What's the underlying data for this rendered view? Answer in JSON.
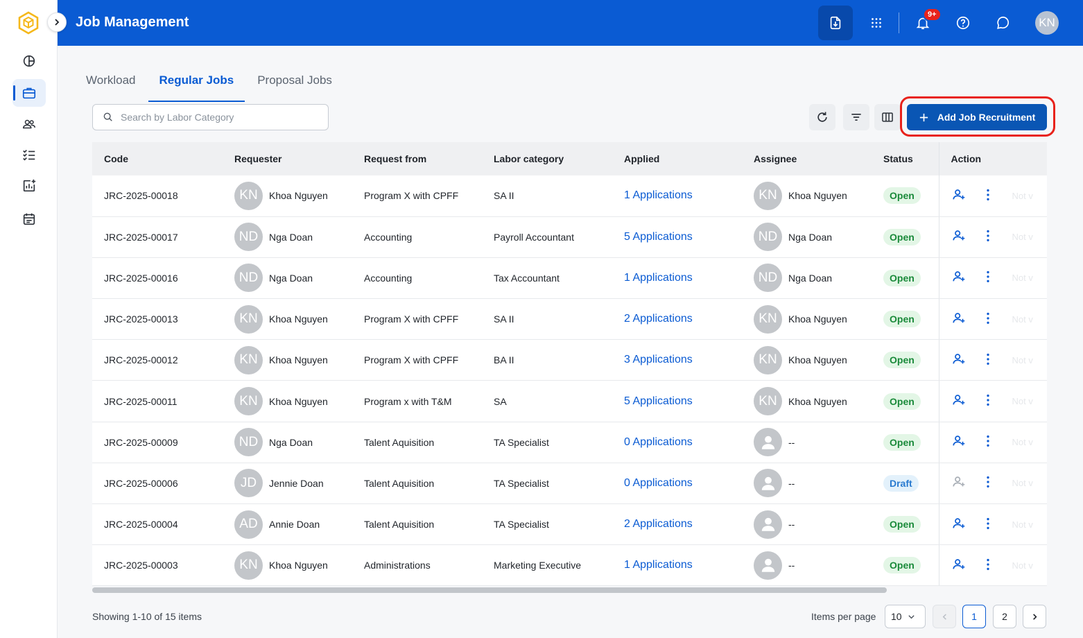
{
  "app": {
    "title": "Job Management",
    "logo_icon": "hexagon-cube-logo",
    "accent_color": "#0a5bd3",
    "header_color": "#0a5bd3"
  },
  "header": {
    "notification_badge": "9+",
    "avatar_initials": "KN",
    "icons": [
      "download-document-icon",
      "apps-grid-icon",
      "bell-icon",
      "help-icon",
      "chat-icon"
    ]
  },
  "sidebar": {
    "items": [
      {
        "name": "dashboard",
        "icon": "pie-chart-icon"
      },
      {
        "name": "jobs",
        "icon": "briefcase-icon",
        "active": true
      },
      {
        "name": "people",
        "icon": "users-icon"
      },
      {
        "name": "tasks",
        "icon": "checklist-icon"
      },
      {
        "name": "reports",
        "icon": "chart-add-icon"
      },
      {
        "name": "calendar",
        "icon": "calendar-icon"
      }
    ]
  },
  "tabs": [
    {
      "label": "Workload",
      "active": false
    },
    {
      "label": "Regular Jobs",
      "active": true
    },
    {
      "label": "Proposal Jobs",
      "active": false
    }
  ],
  "toolbar": {
    "search_placeholder": "Search by Labor Category",
    "add_button_label": "Add Job Recruitment"
  },
  "table": {
    "columns": [
      "Code",
      "Requester",
      "Request from",
      "Labor category",
      "Applied",
      "Assignee",
      "Status",
      "Action"
    ],
    "rows": [
      {
        "code": "JRC-2025-00018",
        "req_initials": "KN",
        "requester": "Khoa Nguyen",
        "from": "Program X with CPFF",
        "labor": "SA II",
        "applied": "1 Applications",
        "asg_initials": "KN",
        "assignee": "Khoa Nguyen",
        "status": "Open"
      },
      {
        "code": "JRC-2025-00017",
        "req_initials": "ND",
        "requester": "Nga Doan",
        "from": "Accounting",
        "labor": "Payroll Accountant",
        "applied": "5 Applications",
        "asg_initials": "ND",
        "assignee": "Nga Doan",
        "status": "Open"
      },
      {
        "code": "JRC-2025-00016",
        "req_initials": "ND",
        "requester": "Nga Doan",
        "from": "Accounting",
        "labor": "Tax Accountant",
        "applied": "1 Applications",
        "asg_initials": "ND",
        "assignee": "Nga Doan",
        "status": "Open"
      },
      {
        "code": "JRC-2025-00013",
        "req_initials": "KN",
        "requester": "Khoa Nguyen",
        "from": "Program X with CPFF",
        "labor": "SA II",
        "applied": "2 Applications",
        "asg_initials": "KN",
        "assignee": "Khoa Nguyen",
        "status": "Open"
      },
      {
        "code": "JRC-2025-00012",
        "req_initials": "KN",
        "requester": "Khoa Nguyen",
        "from": "Program X with CPFF",
        "labor": "BA II",
        "applied": "3 Applications",
        "asg_initials": "KN",
        "assignee": "Khoa Nguyen",
        "status": "Open"
      },
      {
        "code": "JRC-2025-00011",
        "req_initials": "KN",
        "requester": "Khoa Nguyen",
        "from": "Program x with T&M",
        "labor": "SA",
        "applied": "5 Applications",
        "asg_initials": "KN",
        "assignee": "Khoa Nguyen",
        "status": "Open"
      },
      {
        "code": "JRC-2025-00009",
        "req_initials": "ND",
        "requester": "Nga Doan",
        "from": "Talent Aquisition",
        "labor": "TA Specialist",
        "applied": "0 Applications",
        "asg_initials": "",
        "assignee": "--",
        "status": "Open"
      },
      {
        "code": "JRC-2025-00006",
        "req_initials": "JD",
        "requester": "Jennie Doan",
        "from": "Talent Aquisition",
        "labor": "TA Specialist",
        "applied": "0 Applications",
        "asg_initials": "",
        "assignee": "--",
        "status": "Draft"
      },
      {
        "code": "JRC-2025-00004",
        "req_initials": "AD",
        "requester": "Annie Doan",
        "from": "Talent Aquisition",
        "labor": "TA Specialist",
        "applied": "2 Applications",
        "asg_initials": "",
        "assignee": "--",
        "status": "Open"
      },
      {
        "code": "JRC-2025-00003",
        "req_initials": "KN",
        "requester": "Khoa Nguyen",
        "from": "Administrations",
        "labor": "Marketing Executive",
        "applied": "1 Applications",
        "asg_initials": "",
        "assignee": "--",
        "status": "Open"
      }
    ],
    "action_ghost_text": "Not v"
  },
  "footer": {
    "showing": "Showing 1-10 of 15 items",
    "items_per_page_label": "Items per page",
    "items_per_page_value": "10",
    "pages": [
      "1",
      "2"
    ],
    "current_page": "1"
  }
}
